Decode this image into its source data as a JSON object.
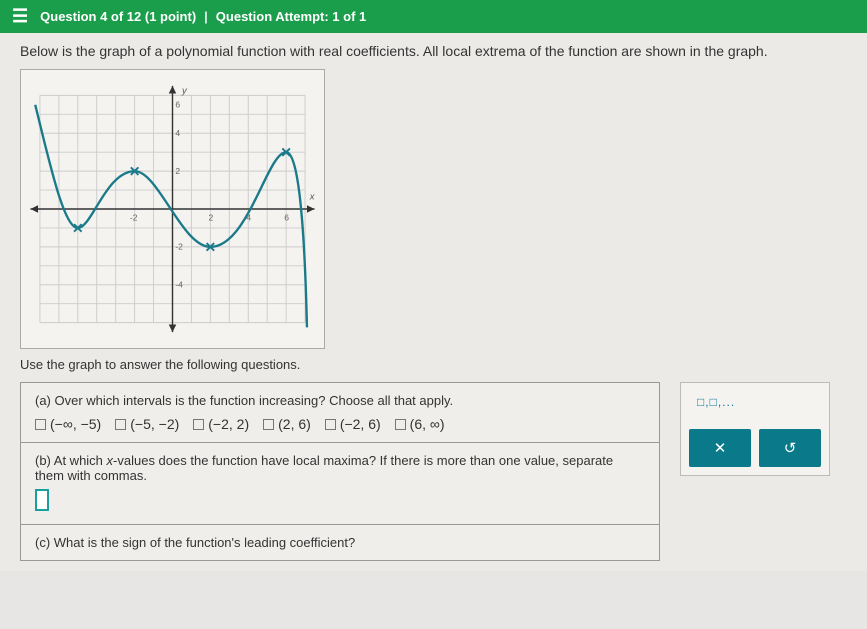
{
  "header": {
    "question_position": "Question 4 of 12 (1 point)",
    "attempt": "Question Attempt: 1 of 1"
  },
  "prompt": "Below is the graph of a polynomial function with real coefficients. All local extrema of the function are shown in the graph.",
  "subprompt": "Use the graph to answer the following questions.",
  "questions": {
    "a": {
      "text": "(a) Over which intervals is the function increasing? Choose all that apply.",
      "options": [
        "(−∞, −5)",
        "(−5, −2)",
        "(−2, 2)",
        "(2, 6)",
        "(−2, 6)",
        "(6, ∞)"
      ]
    },
    "b": {
      "text_prefix": "(b) At which ",
      "text_var": "x",
      "text_suffix": "-values does the function have local maxima? If there is more than one value, separate them with commas."
    },
    "c": {
      "text": "(c) What is the sign of the function's leading coefficient?"
    }
  },
  "sidepanel": {
    "interval_tool": "□,□,..."
  },
  "chart_data": {
    "type": "line",
    "title": "",
    "xlabel": "x",
    "ylabel": "y",
    "xlim": [
      -8,
      8
    ],
    "ylim": [
      -8,
      8
    ],
    "extrema": [
      {
        "x": -5,
        "y": -1,
        "type": "local_min"
      },
      {
        "x": -2,
        "y": 2,
        "type": "local_max"
      },
      {
        "x": 2,
        "y": -2,
        "type": "local_min"
      },
      {
        "x": 6,
        "y": 3,
        "type": "local_max"
      }
    ],
    "grid": true
  }
}
